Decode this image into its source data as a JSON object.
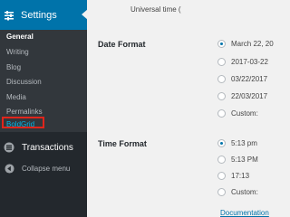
{
  "sidebar": {
    "settings_label": "Settings",
    "submenu": [
      "General",
      "Writing",
      "Blog",
      "Discussion",
      "Media",
      "Permalinks",
      "BoldGrid"
    ],
    "transactions_label": "Transactions",
    "collapse_label": "Collapse menu"
  },
  "main": {
    "timezone_text": "Universal time (",
    "date_format": {
      "label": "Date Format",
      "options": [
        "March 22, 20",
        "2017-03-22",
        "03/22/2017",
        "22/03/2017",
        "Custom:"
      ],
      "selected_index": 0
    },
    "time_format": {
      "label": "Time Format",
      "options": [
        "5:13 pm",
        "5:13 PM",
        "17:13",
        "Custom:"
      ],
      "selected_index": 0
    },
    "documentation_link": "Documentation"
  },
  "colors": {
    "sidebar_bg": "#23282d",
    "submenu_bg": "#32373c",
    "active_blue": "#0073aa",
    "boldgrid_link": "#00b9eb",
    "highlight_box": "#e0251b"
  }
}
